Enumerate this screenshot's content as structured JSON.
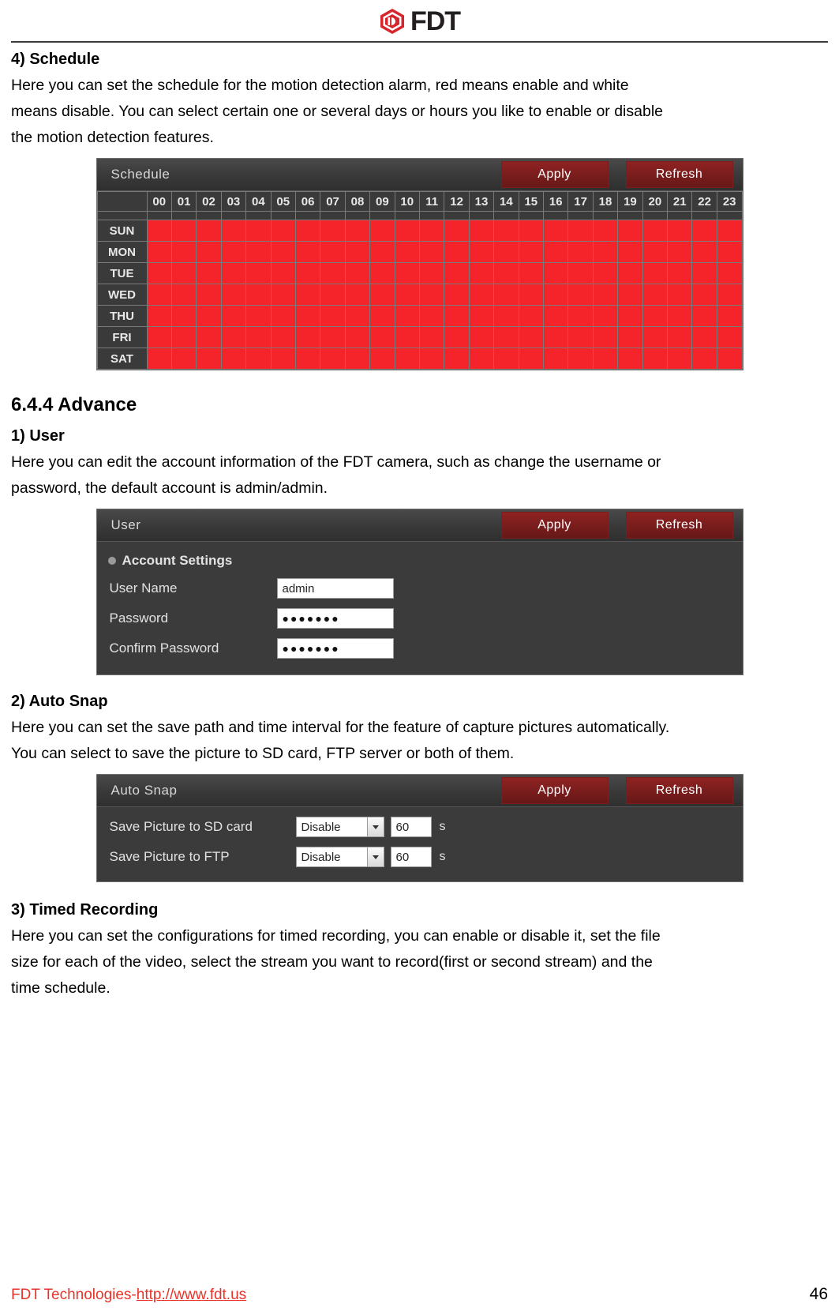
{
  "header": {
    "logo_text": "FDT",
    "logo_icon": "fdt-hexagon-logo-icon"
  },
  "sections": {
    "schedule": {
      "heading": "4) Schedule",
      "paragraph_lines": [
        "Here you can set the schedule for the motion detection alarm, red means enable and white",
        "means disable. You can select certain one or several days or hours you like to enable or disable",
        "the motion detection features."
      ]
    },
    "advance": {
      "heading": "6.4.4 Advance"
    },
    "user": {
      "heading": "1) User",
      "paragraph_lines": [
        "Here you can edit the account information of the FDT camera, such as change the username or",
        "password, the default account is admin/admin."
      ]
    },
    "autosnap": {
      "heading": "2) Auto Snap",
      "paragraph_lines": [
        "Here you can set the save path and time interval for the feature of capture pictures automatically.",
        "You can select to save the picture to SD card, FTP server or both of them."
      ]
    },
    "timed_recording": {
      "heading": "3) Timed Recording",
      "paragraph_lines": [
        "Here you can set the configurations for timed recording, you can enable or disable it, set the file",
        "size for each of the video, select the stream you want to record(first or second stream) and the",
        "time schedule."
      ]
    }
  },
  "schedule_widget": {
    "title": "Schedule",
    "apply_label": "Apply",
    "refresh_label": "Refresh",
    "hours": [
      "00",
      "01",
      "02",
      "03",
      "04",
      "05",
      "06",
      "07",
      "08",
      "09",
      "10",
      "11",
      "12",
      "13",
      "14",
      "15",
      "16",
      "17",
      "18",
      "19",
      "20",
      "21",
      "22",
      "23"
    ],
    "days": [
      "SUN",
      "MON",
      "TUE",
      "WED",
      "THU",
      "FRI",
      "SAT"
    ],
    "all_enabled": true,
    "enabled_color": "#f5232a",
    "disabled_color": "#ffffff"
  },
  "user_widget": {
    "title": "User",
    "apply_label": "Apply",
    "refresh_label": "Refresh",
    "group_label": "Account Settings",
    "fields": [
      {
        "label": "User Name",
        "value": "admin",
        "masked": false
      },
      {
        "label": "Password",
        "value": "●●●●●●●",
        "masked": true
      },
      {
        "label": "Confirm Password",
        "value": "●●●●●●●",
        "masked": true
      }
    ]
  },
  "autosnap_widget": {
    "title": "Auto Snap",
    "apply_label": "Apply",
    "refresh_label": "Refresh",
    "rows": [
      {
        "label": "Save Picture to SD card",
        "select_value": "Disable",
        "interval": "60",
        "unit": "s"
      },
      {
        "label": "Save Picture to FTP",
        "select_value": "Disable",
        "interval": "60",
        "unit": "s"
      }
    ]
  },
  "footer": {
    "company": "FDT Technologies-",
    "url": "http://www.fdt.us",
    "page_number": "46"
  }
}
